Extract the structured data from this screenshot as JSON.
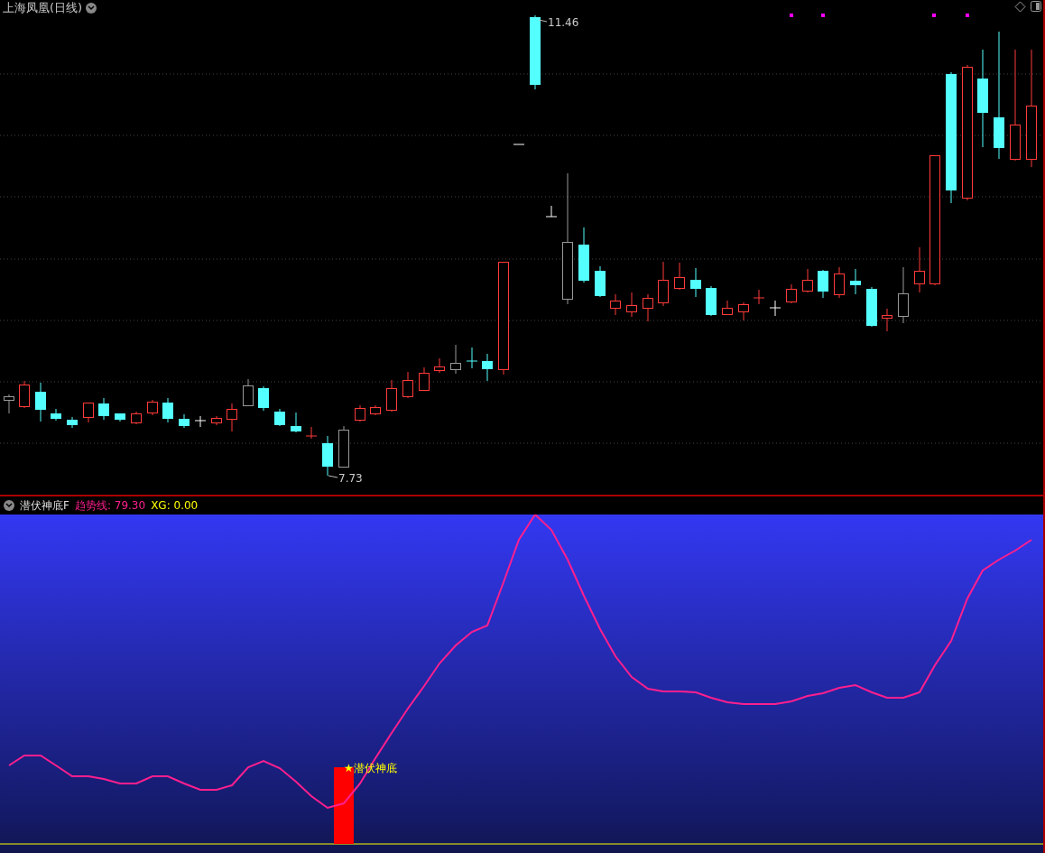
{
  "main_chart": {
    "title": "上海凤凰(日线)",
    "high_label": "11.46",
    "low_label": "7.73"
  },
  "indicator": {
    "name": "潜伏神底F",
    "legend": [
      {
        "kind": "trend",
        "label": "趋势线:",
        "value": "79.30"
      },
      {
        "kind": "signal",
        "label": "XG:",
        "value": "0.00"
      }
    ],
    "signal_label": "★潜伏神底"
  }
}
